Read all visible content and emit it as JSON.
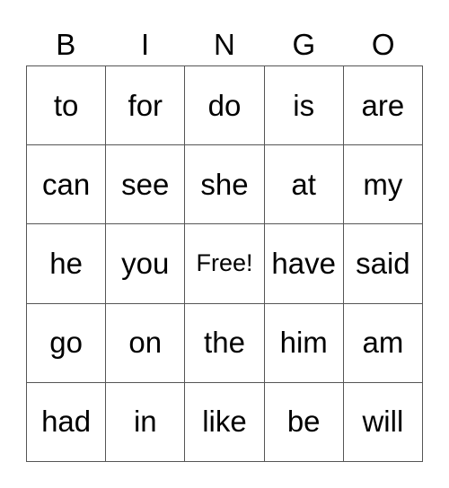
{
  "header": [
    "B",
    "I",
    "N",
    "G",
    "O"
  ],
  "cells": [
    [
      "to",
      "for",
      "do",
      "is",
      "are"
    ],
    [
      "can",
      "see",
      "she",
      "at",
      "my"
    ],
    [
      "he",
      "you",
      "Free!",
      "have",
      "said"
    ],
    [
      "go",
      "on",
      "the",
      "him",
      "am"
    ],
    [
      "had",
      "in",
      "like",
      "be",
      "will"
    ]
  ],
  "free_cell": {
    "row": 2,
    "col": 2
  }
}
